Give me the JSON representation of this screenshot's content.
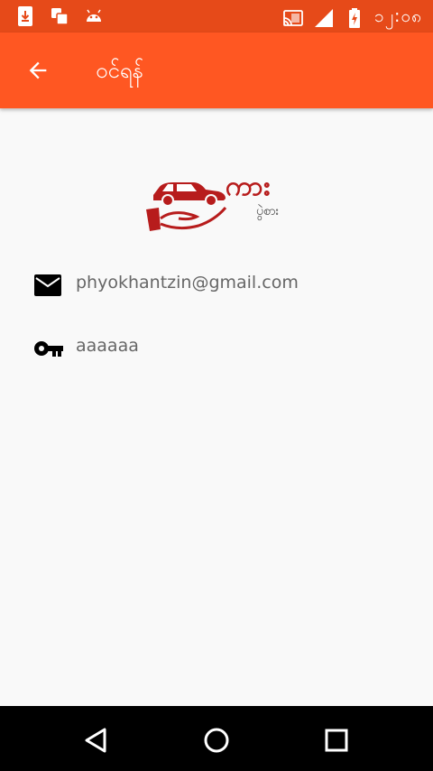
{
  "status_bar": {
    "clock": "၁၂:၀၈",
    "left_icons": [
      "download-icon",
      "cards-icon",
      "android-icon"
    ],
    "right_icons": [
      "cast-icon",
      "signal-icon",
      "battery-charging-icon"
    ]
  },
  "app_bar": {
    "title": "ဝင်ရန်",
    "back_icon": "back-arrow-icon"
  },
  "logo": {
    "main_text": "ကား",
    "sub_text": "ပွဲစား"
  },
  "form": {
    "email_value": "phyokhantzin@gmail.com",
    "email_icon": "email-icon",
    "password_value": "aaaaaa",
    "password_icon": "key-icon"
  },
  "nav_bar": {
    "buttons": [
      "back-triangle-icon",
      "home-circle-icon",
      "recents-square-icon"
    ]
  },
  "colors": {
    "status_bar": "#e64a19",
    "app_bar": "#ff5722",
    "logo": "#b71c1c",
    "background": "#f9f9f9"
  }
}
